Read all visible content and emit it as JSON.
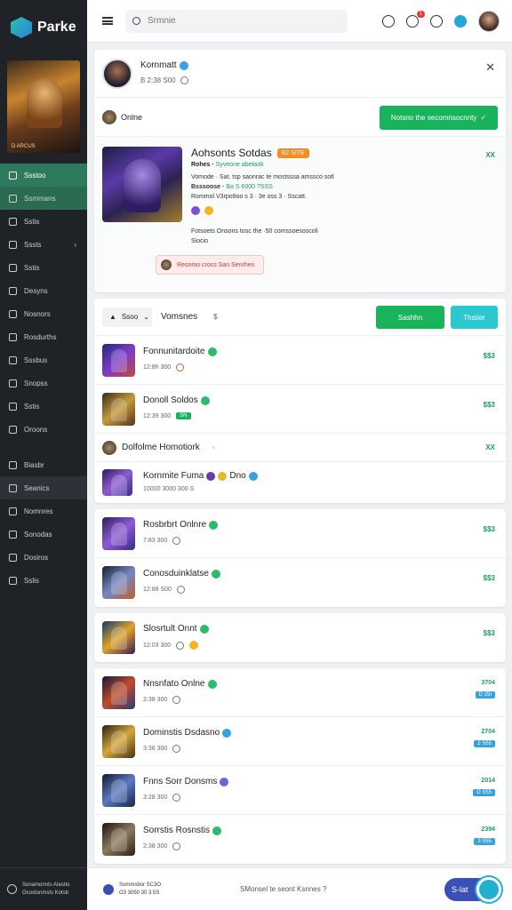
{
  "app": {
    "name": "Parke"
  },
  "sidebar": {
    "banner_caption": "D ARCUS",
    "items": [
      {
        "label": "Ssstoo"
      },
      {
        "label": "Ssmmans"
      },
      {
        "label": "Sstis"
      },
      {
        "label": "Sssts"
      },
      {
        "label": "Sstis"
      },
      {
        "label": "Desyns"
      },
      {
        "label": "Nosnors"
      },
      {
        "label": "Rosdurths"
      },
      {
        "label": "Sssbus"
      },
      {
        "label": "Snopss"
      },
      {
        "label": "Sstis"
      },
      {
        "label": "Oroons"
      },
      {
        "label": "Biasbr"
      },
      {
        "label": "Seanics"
      },
      {
        "label": "Nomnres"
      },
      {
        "label": "Sonodas"
      },
      {
        "label": "Dosiros"
      },
      {
        "label": "Sslis"
      }
    ],
    "footer_line1": "Sonamonnts Atestio",
    "footer_line2": "Ocostonmsts Kotsb"
  },
  "topbar": {
    "search_placeholder": "Srmnie",
    "badge": "1"
  },
  "profile": {
    "name": "Kornmatt",
    "meta": "B 2:38 S00",
    "close": "✕"
  },
  "online": {
    "label": "Onlne",
    "button": "Notsno the secomnsocnnty"
  },
  "featured": {
    "title": "Aohsonts Sotdas",
    "tag": "B2 SITE",
    "sub_prefix": "Rohes ·",
    "sub_green": "Syveone abetaok",
    "line1": "Vomode · Sat. tsp saonrac te mostsssa amssco sotl",
    "line2_prefix": "Bsssoose ·",
    "line2_green": "Ba S 6000 ?SSS",
    "line3": "Rommol V3rpo9oo s 3 · 3e oss 3 · Sscatt.",
    "line4": "Fotsoets Onsons tosc the ·50 comssoesoscoli",
    "line5": "Siocio",
    "pill": "Resnmo crocs San Senrhes",
    "score": "XX"
  },
  "filter": {
    "select": "Ssoo",
    "label": "Vomsnes",
    "sort": "$",
    "btn_green": "Sashhn",
    "btn_teal": "Thstier"
  },
  "rows_a": [
    {
      "name": "Fonnunitardoite",
      "meta": "12:8h 300",
      "score": "$$3"
    },
    {
      "name": "Donoll Soldos",
      "meta": "12:39 300",
      "score": "$$3",
      "chip": "SN"
    }
  ],
  "section_b": {
    "title": "Dolfolme Homotiork",
    "score": "XX"
  },
  "row_b": {
    "name": "Kornmite Fuma",
    "tail": "Dno",
    "meta": "10000 3000 300 S"
  },
  "rows_c": [
    {
      "name": "Rosbrbrt Onlnre",
      "meta": "7:83 300",
      "score": "$$3"
    },
    {
      "name": "Conosduinklatse",
      "meta": "12:88 S00",
      "score": "$$3"
    }
  ],
  "row_d": {
    "name": "Slosrtult Onnt",
    "meta": "12:03 300",
    "score": "$$3"
  },
  "rows_e": [
    {
      "name": "Nnsnfato Onlne",
      "meta": "2:38 300",
      "score": "3704",
      "tag": "D 25I"
    },
    {
      "name": "Dominstis Dsdasno",
      "meta": "3:38 300",
      "score": "2704",
      "tag": "2 S55"
    },
    {
      "name": "Fnns Sorr Donsms",
      "meta": "3:28 300",
      "score": "2014",
      "tag": "D S55"
    },
    {
      "name": "Sorrstis Rosnstis",
      "meta": "2:38 300",
      "score": "2394",
      "tag": "3 S55"
    }
  ],
  "footer": {
    "line1": "Sommsbor SC3O",
    "line2": "O3 3050 30 3 5S",
    "center": "SMonsel te seont Ksnnes ?",
    "button": "S-lat"
  }
}
